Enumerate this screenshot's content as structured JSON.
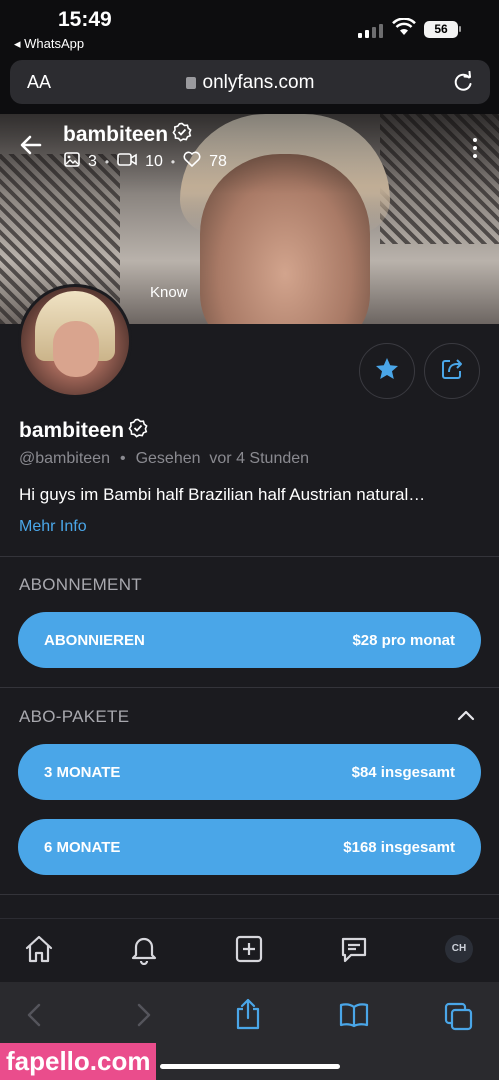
{
  "status_bar": {
    "time": "15:49",
    "back_app": "WhatsApp",
    "battery": "56"
  },
  "browser": {
    "text_size": "AA",
    "url": "onlyfans.com"
  },
  "header": {
    "name": "bambiteen",
    "photos": "3",
    "videos": "10",
    "likes": "78",
    "cover_caption": "Know"
  },
  "profile": {
    "name": "bambiteen",
    "handle": "@bambiteen",
    "separator": "•",
    "last_seen": "Gesehen  vor 4 Stunden",
    "bio": "Hi guys im Bambi half Brazilian half Austrian natural…",
    "more_info": "Mehr Info"
  },
  "subscription": {
    "title": "ABONNEMENT",
    "button_label": "ABONNIEREN",
    "button_price": "$28 pro monat"
  },
  "bundles": {
    "title": "ABO-PAKETE",
    "items": [
      {
        "label": "3 MONATE",
        "price": "$84 insgesamt"
      },
      {
        "label": "6 MONATE",
        "price": "$168 insgesamt"
      }
    ]
  },
  "app_nav": {
    "avatar_initials": "CH"
  },
  "watermark": "fapello.com",
  "colors": {
    "accent": "#4aa6e8",
    "background": "#1b1b1f",
    "watermark": "#ea4d8c"
  },
  "icons": [
    "back-arrow-icon",
    "verified-badge-icon",
    "image-icon",
    "video-icon",
    "heart-icon",
    "kebab-icon",
    "star-icon",
    "share-icon",
    "chevron-up-icon",
    "home-icon",
    "bell-icon",
    "add-square-icon",
    "message-icon",
    "safari-back-icon",
    "safari-forward-icon",
    "safari-share-icon",
    "bookmarks-icon",
    "tabs-icon",
    "reload-icon",
    "lock-icon"
  ]
}
